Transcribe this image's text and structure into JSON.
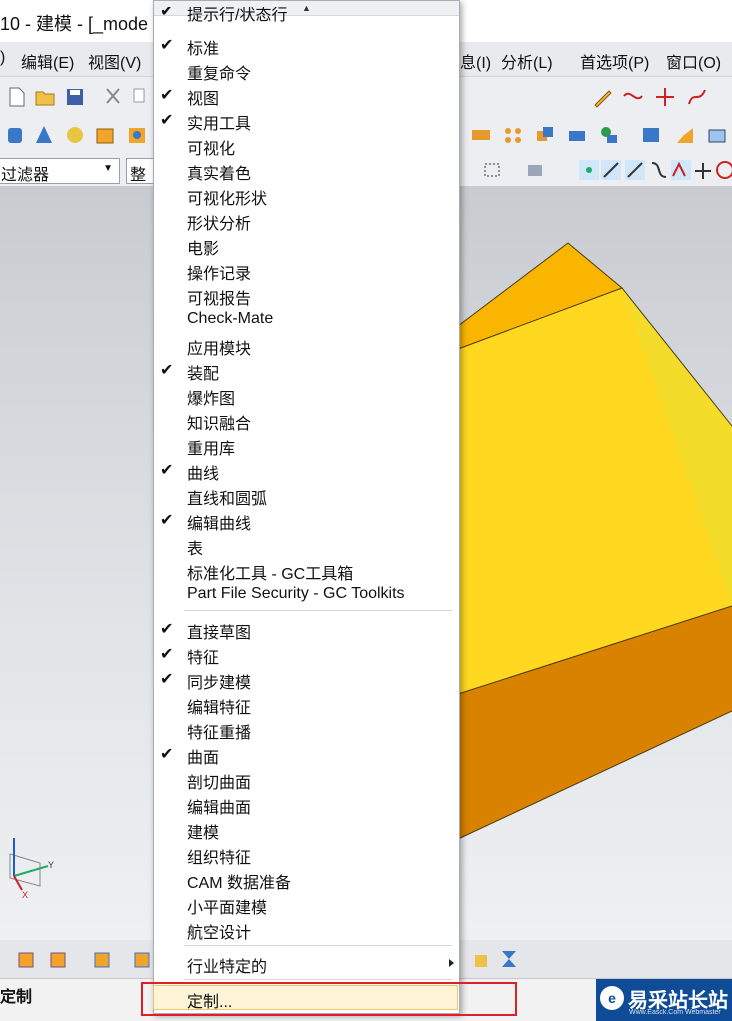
{
  "window": {
    "title": "10 - 建模 - [_mode"
  },
  "menubar": {
    "items": [
      "编辑(E)",
      "视图(V)",
      "息(I)",
      "分析(L)",
      "首选项(P)",
      "窗口(O)"
    ],
    "left_fragment": ")"
  },
  "filter": {
    "value": "过滤器",
    "scope_fragment": "整"
  },
  "popup": {
    "top_fragment": "提示行/状态行",
    "items": [
      {
        "label": "标准",
        "checked": true
      },
      {
        "label": "重复命令",
        "checked": false
      },
      {
        "label": "视图",
        "checked": true
      },
      {
        "label": "实用工具",
        "checked": true
      },
      {
        "label": "可视化",
        "checked": false
      },
      {
        "label": "真实着色",
        "checked": false
      },
      {
        "label": "可视化形状",
        "checked": false
      },
      {
        "label": "形状分析",
        "checked": false
      },
      {
        "label": "电影",
        "checked": false
      },
      {
        "label": "操作记录",
        "checked": false
      },
      {
        "label": "可视报告",
        "checked": false
      },
      {
        "label": "Check-Mate",
        "checked": false
      },
      {
        "label": "应用模块",
        "checked": false
      },
      {
        "label": "装配",
        "checked": true
      },
      {
        "label": "爆炸图",
        "checked": false
      },
      {
        "label": "知识融合",
        "checked": false
      },
      {
        "label": "重用库",
        "checked": false
      },
      {
        "label": "曲线",
        "checked": true
      },
      {
        "label": "直线和圆弧",
        "checked": false
      },
      {
        "label": "编辑曲线",
        "checked": true
      },
      {
        "label": "表",
        "checked": false
      },
      {
        "label": "标准化工具 - GC工具箱",
        "checked": false
      },
      {
        "label": "Part File Security - GC Toolkits",
        "checked": false
      }
    ],
    "items2": [
      {
        "label": "直接草图",
        "checked": true
      },
      {
        "label": "特征",
        "checked": true
      },
      {
        "label": "同步建模",
        "checked": true
      },
      {
        "label": "编辑特征",
        "checked": false
      },
      {
        "label": "特征重播",
        "checked": false
      },
      {
        "label": "曲面",
        "checked": true
      },
      {
        "label": "剖切曲面",
        "checked": false
      },
      {
        "label": "编辑曲面",
        "checked": false
      },
      {
        "label": "建模",
        "checked": false
      },
      {
        "label": "组织特征",
        "checked": false
      },
      {
        "label": "CAM 数据准备",
        "checked": false
      },
      {
        "label": "小平面建模",
        "checked": false
      },
      {
        "label": "航空设计",
        "checked": false
      }
    ],
    "industry": "行业特定的",
    "customize": "定制...",
    "check_glyph": "✔"
  },
  "statusbar": {
    "text": "定制"
  },
  "watermark": {
    "text": "易采站长站",
    "sub": "Www.Easck.Com  Webmaster"
  },
  "colors": {
    "block_top": "#f9b500",
    "block_front": "#ffd81f",
    "block_side": "#f4dc2a",
    "block_bottom": "#d98200",
    "highlight_border": "#e01f2a"
  }
}
